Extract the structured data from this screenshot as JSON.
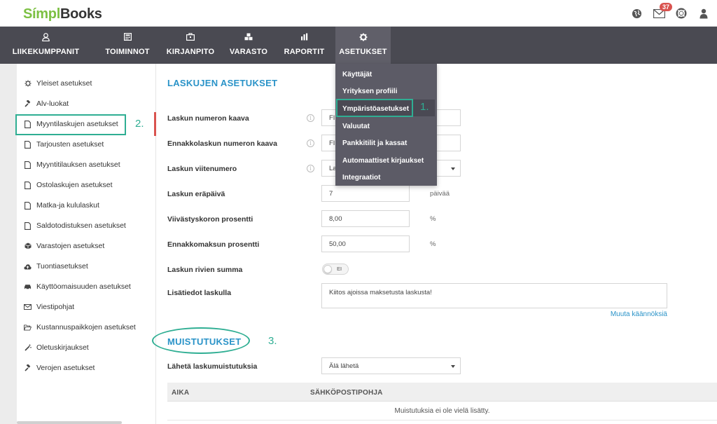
{
  "brand": {
    "logo_part1": "Símpl",
    "logo_part2": "Books"
  },
  "topbar": {
    "notifications_count": "37"
  },
  "nav": [
    {
      "label": "LIIKEKUMPPANIT",
      "icon": "person-icon"
    },
    {
      "label": "TOIMINNOT",
      "icon": "calculator-icon"
    },
    {
      "label": "KIRJANPITO",
      "icon": "briefcase-icon"
    },
    {
      "label": "VARASTO",
      "icon": "cubes-icon"
    },
    {
      "label": "RAPORTIT",
      "icon": "bar-chart-icon"
    },
    {
      "label": "ASETUKSET",
      "icon": "gear-icon"
    }
  ],
  "sidebar": {
    "items": [
      {
        "label": "Yleiset asetukset",
        "icon": "gear-icon"
      },
      {
        "label": "Alv-luokat",
        "icon": "gavel-icon"
      },
      {
        "label": "Myyntilaskujen asetukset",
        "icon": "document-icon"
      },
      {
        "label": "Tarjousten asetukset",
        "icon": "document-icon"
      },
      {
        "label": "Myyntitilauksen asetukset",
        "icon": "document-icon"
      },
      {
        "label": "Ostolaskujen asetukset",
        "icon": "document-icon"
      },
      {
        "label": "Matka-ja kululaskut",
        "icon": "document-icon"
      },
      {
        "label": "Saldotodistuksen asetukset",
        "icon": "document-icon"
      },
      {
        "label": "Varastojen asetukset",
        "icon": "cube-icon"
      },
      {
        "label": "Tuontiasetukset",
        "icon": "cloud-upload-icon"
      },
      {
        "label": "Käyttöomaisuuden asetukset",
        "icon": "car-icon"
      },
      {
        "label": "Viestipohjat",
        "icon": "envelope-icon"
      },
      {
        "label": "Kustannuspaikkojen asetukset",
        "icon": "folder-open-icon"
      },
      {
        "label": "Oletuskirjaukset",
        "icon": "magic-wand-icon"
      },
      {
        "label": "Verojen asetukset",
        "icon": "gavel-icon"
      }
    ]
  },
  "main": {
    "section_title": "LASKUJEN ASETUKSET",
    "fields": {
      "invoice_number_formula": {
        "label": "Laskun numeron kaava",
        "value": "FI"
      },
      "advance_invoice_number_formula": {
        "label": "Ennakkolaskun numeron kaava",
        "value": "FI"
      },
      "invoice_reference": {
        "label": "Laskun viitenumero",
        "value": "Las"
      },
      "due_date": {
        "label": "Laskun eräpäivä",
        "value": "7",
        "unit": "päivää"
      },
      "late_interest": {
        "label": "Viivästyskoron prosentti",
        "value": "8,00",
        "unit": "%"
      },
      "advance_payment": {
        "label": "Ennakkomaksun prosentti",
        "value": "50,00",
        "unit": "%"
      },
      "row_sum": {
        "label": "Laskun rivien summa",
        "toggle_label": "EI"
      },
      "extra_info": {
        "label": "Lisätiedot laskulla",
        "value": "Kiitos ajoissa maksetusta laskusta!"
      }
    },
    "translations_link": "Muuta käännöksiä",
    "reminders": {
      "section_title": "MUISTUTUKSET",
      "send_label": "Lähetä laskumuistutuksia",
      "send_value": "Älä lähetä",
      "columns": [
        "AIKA",
        "SÄHKÖPOSTIPOHJA"
      ],
      "empty_message": "Muistutuksia ei ole vielä lisätty."
    }
  },
  "dropdown": {
    "items": [
      "Käyttäjät",
      "Yrityksen profiili",
      "Ympäristöasetukset",
      "Valuutat",
      "Pankkitilit ja kassat",
      "Automaattiset kirjaukset",
      "Integraatiot"
    ]
  },
  "annotations": {
    "step1": "1.",
    "step2": "2.",
    "step3": "3."
  },
  "colors": {
    "brand_green": "#7cc043",
    "accent_blue": "#2a93c8",
    "highlight_teal": "#2fae93",
    "nav_bg": "#4a4a52",
    "active_red": "#d9534f"
  }
}
